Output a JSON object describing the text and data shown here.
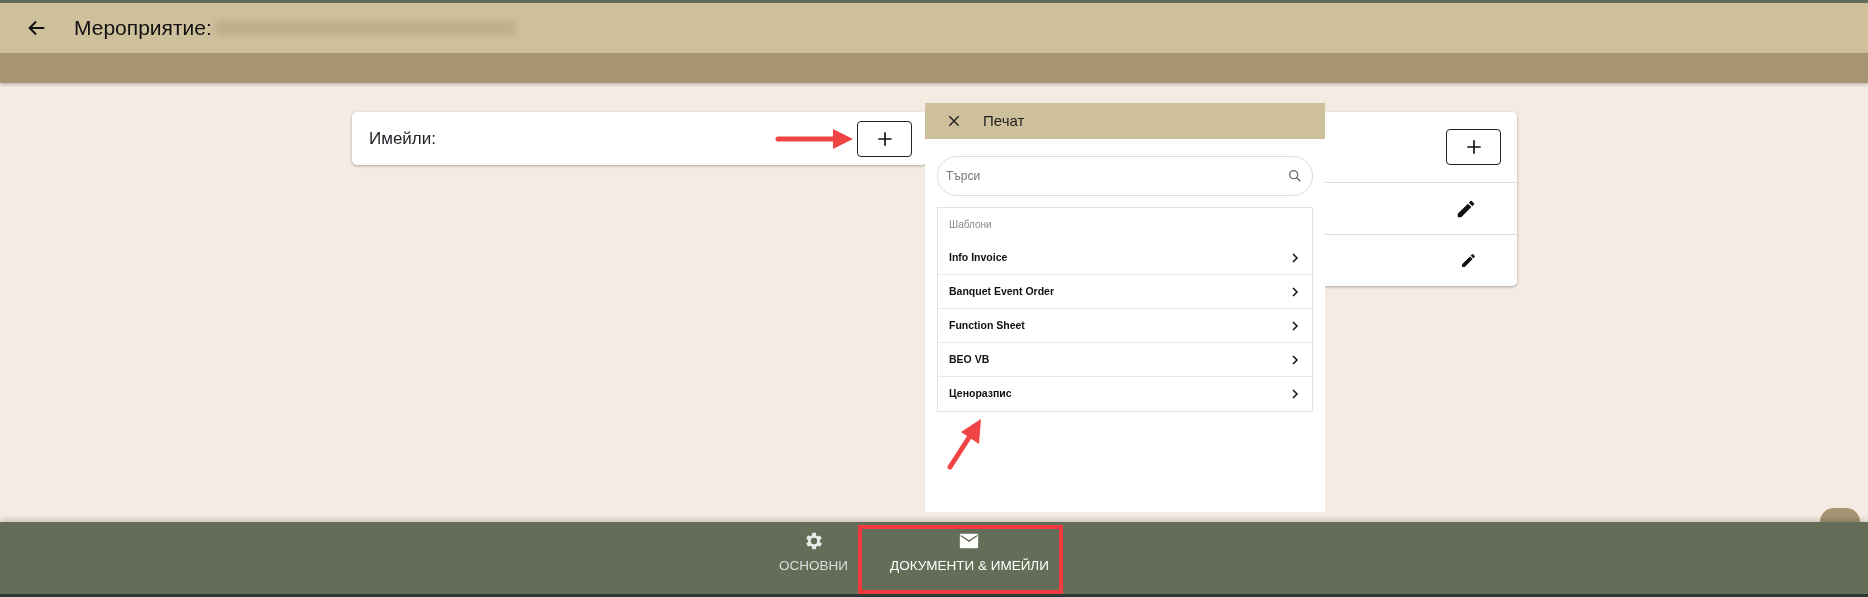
{
  "header": {
    "title": "Мероприятие:"
  },
  "emails_card": {
    "label": "Имейли:"
  },
  "documents_card": {
    "rows": [
      {
        "kind": "edit"
      },
      {
        "kind": "edit"
      }
    ]
  },
  "print_dialog": {
    "title": "Печат",
    "search": {
      "placeholder": "Търси"
    },
    "section": "Шаблони",
    "templates": [
      {
        "label": "Info Invoice"
      },
      {
        "label": "Banquet Event Order"
      },
      {
        "label": "Function Sheet"
      },
      {
        "label": "BEO VB"
      },
      {
        "label": "Ценоразпис"
      }
    ]
  },
  "bottom_nav": [
    {
      "label": "ОСНОВНИ",
      "selected": false
    },
    {
      "label": "ДОКУМЕНТИ & ИМЕЙЛИ",
      "selected": true
    }
  ]
}
